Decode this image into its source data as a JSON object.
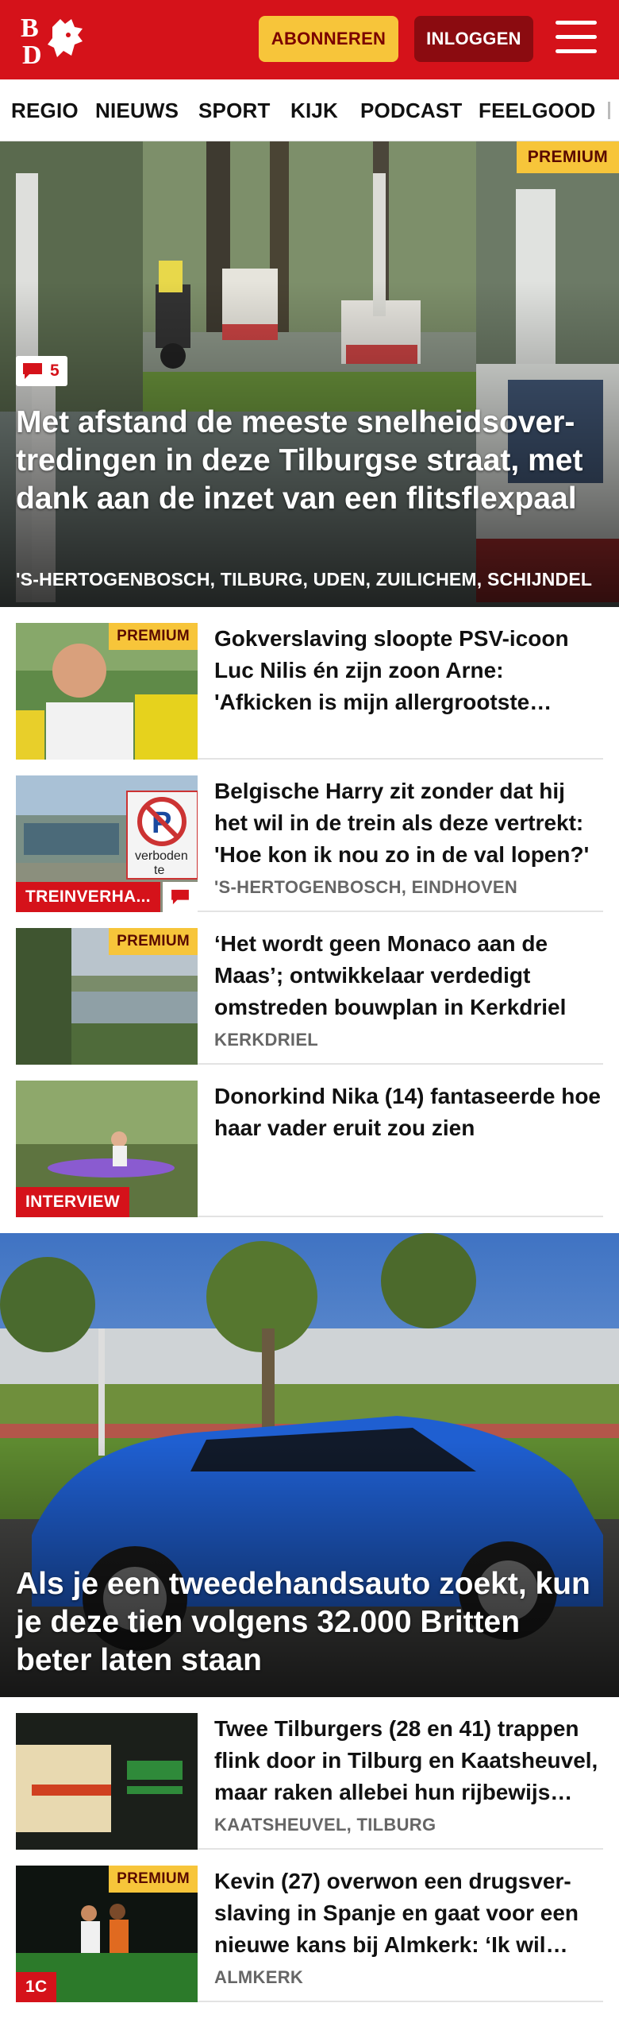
{
  "header": {
    "logo_text": "BD",
    "subscribe_label": "ABONNEREN",
    "login_label": "INLOGGEN"
  },
  "nav": [
    "REGIO",
    "NIEUWS",
    "SPORT",
    "KIJK",
    "PODCAST",
    "FEELGOOD"
  ],
  "hero1": {
    "badge": "PREMIUM",
    "comments": "5",
    "title": "Met afstand de meeste snelheidsover­tredingen in deze Tilburgse straat, met dank aan de inzet van een flitsflexpaal",
    "locations": "'S-HERTOGENBOSCH, TILBURG, UDEN, ZUILICHEM, SCHIJNDEL"
  },
  "articles_a": [
    {
      "title": "Gokverslaving sloopte PSV-icoon Luc Nilis én zijn zoon Arne: 'Afkicken is mijn allergrootste overwinning'",
      "premium": "PREMIUM",
      "label": "",
      "location": ""
    },
    {
      "title": "Belgische Harry zit zonder dat hij het wil in de trein als deze vertrekt: 'Hoe kon ik nou zo in de val lopen?'",
      "premium": "",
      "label": "TREINVERHAAL",
      "location": "'S-HERTOGENBOSCH, EINDHOVEN"
    },
    {
      "title": "‘Het wordt geen Monaco aan de Maas’; ontwikkelaar verdedigt omstreden bouwplan in Kerkdriel",
      "premium": "PREMIUM",
      "label": "",
      "location": "KERKDRIEL"
    },
    {
      "title": "Donorkind Nika (14) fantaseerde hoe haar vader eruit zou zien",
      "premium": "",
      "label": "INTERVIEW",
      "location": ""
    }
  ],
  "hero2": {
    "title": "Als je een tweedehandsauto zoekt, kun je deze tien volgens 32.000 Britten beter laten staan"
  },
  "articles_b": [
    {
      "title": "Twee Tilburgers (28 en 41) trappen flink door in Tilburg en Kaatsheuvel, maar raken allebei hun rijbewijs kwijt",
      "premium": "",
      "label": "",
      "location": "KAATSHEUVEL, TILBURG"
    },
    {
      "title": "Kevin (27) overwon een drugsver­slaving in Spanje en gaat voor een nieuwe kans bij Almkerk: ‘Ik wil laten zien wat ik kan’",
      "premium": "PREMIUM",
      "label": "1C",
      "location": "ALMKERK"
    }
  ],
  "colors": {
    "brand_red": "#d5121a",
    "premium_yellow": "#f7c53a",
    "login_dark_red": "#8b0b10"
  }
}
